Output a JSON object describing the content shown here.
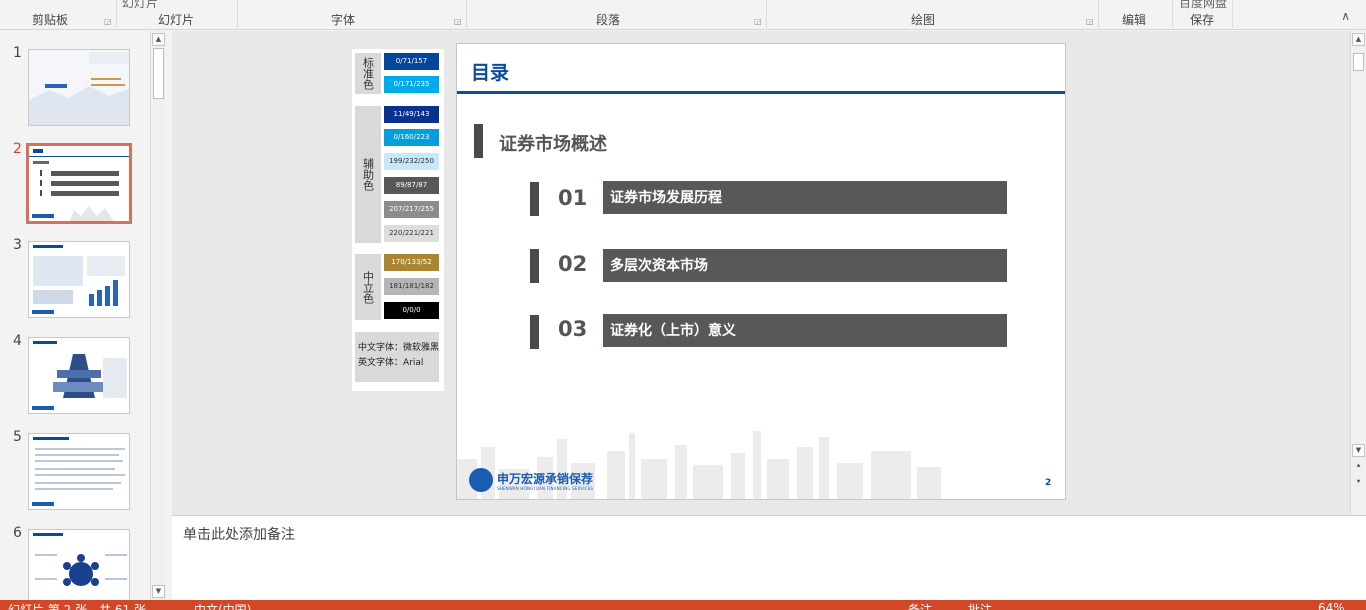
{
  "ribbon": {
    "groups": [
      {
        "label": "剪贴板"
      },
      {
        "label": "幻灯片"
      },
      {
        "label": "字体"
      },
      {
        "label": "段落"
      },
      {
        "label": "绘图"
      },
      {
        "label": "编辑"
      },
      {
        "label": "保存"
      }
    ],
    "cut_top": [
      "幻灯片",
      "百度网盘"
    ]
  },
  "thumbnails": [
    {
      "number": "1"
    },
    {
      "number": "2"
    },
    {
      "number": "3"
    },
    {
      "number": "4"
    },
    {
      "number": "5"
    },
    {
      "number": "6"
    }
  ],
  "legend": {
    "standard_label": "标准色",
    "aux_label": "辅助色",
    "neutral_label": "中立色",
    "swatches": [
      {
        "text": "0/71/157",
        "color": "#00479d"
      },
      {
        "text": "0/171/235",
        "color": "#00abeb"
      },
      {
        "text": "11/49/143",
        "color": "#0b318f"
      },
      {
        "text": "0/160/223",
        "color": "#00a0df"
      },
      {
        "text": "199/232/250",
        "color": "#c7e8fa"
      },
      {
        "text": "89/87/87",
        "color": "#595757"
      },
      {
        "text": "207/217/255",
        "color": "#8c8c8c"
      },
      {
        "text": "220/221/221",
        "color": "#dcdddd"
      },
      {
        "text": "170/133/52",
        "color": "#aa8534"
      },
      {
        "text": "181/181/182",
        "color": "#b5b5b6"
      },
      {
        "text": "0/0/0",
        "color": "#000000"
      }
    ],
    "font_cn": "中文字体：微软雅黑",
    "font_en": "英文字体：Arial"
  },
  "slide": {
    "title": "目录",
    "section": "证券市场概述",
    "items": [
      {
        "num": "01",
        "text": "证券市场发展历程"
      },
      {
        "num": "02",
        "text": "多层次资本市场"
      },
      {
        "num": "03",
        "text": "证券化（上市）意义"
      }
    ],
    "logo_cn": "申万宏源承销保荐",
    "logo_en": "SHENWAN HONGYUAN FINANCING SERVICES",
    "page": "2"
  },
  "notes": {
    "placeholder": "单击此处添加备注"
  },
  "status": {
    "slide_info": "幻灯片 第 2 张，共 61 张",
    "language": "中文(中国)",
    "notes_btn": "备注",
    "comments_btn": "批注",
    "zoom": "64%"
  },
  "colors": {
    "accent": "#d24726",
    "brand": "#0b4a9c"
  }
}
